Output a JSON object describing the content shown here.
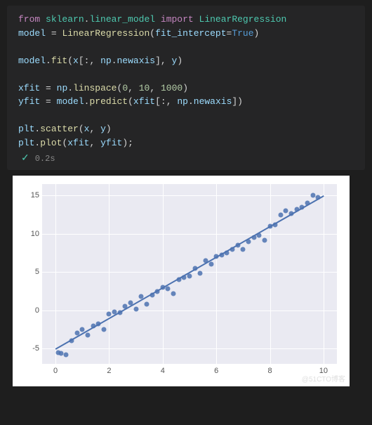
{
  "code": {
    "lines": [
      {
        "tokens": [
          [
            "kw",
            "from"
          ],
          [
            "",
            ""
          ],
          [
            "mod",
            "sklearn"
          ],
          [
            "punc",
            "."
          ],
          [
            "mod",
            "linear_model"
          ],
          [
            "",
            ""
          ],
          [
            "kw",
            "import"
          ],
          [
            "",
            ""
          ],
          [
            "mod",
            "LinearRegression"
          ]
        ]
      },
      {
        "tokens": [
          [
            "var",
            "model"
          ],
          [
            "",
            ""
          ],
          [
            "op",
            "="
          ],
          [
            "",
            ""
          ],
          [
            "fn",
            "LinearRegression"
          ],
          [
            "punc",
            "("
          ],
          [
            "param",
            "fit_intercept"
          ],
          [
            "op",
            "="
          ],
          [
            "bool",
            "True"
          ],
          [
            "punc",
            ")"
          ]
        ]
      },
      {
        "tokens": []
      },
      {
        "tokens": [
          [
            "var",
            "model"
          ],
          [
            "punc",
            "."
          ],
          [
            "fn",
            "fit"
          ],
          [
            "punc",
            "("
          ],
          [
            "var",
            "x"
          ],
          [
            "punc",
            "[:,"
          ],
          [
            "",
            ""
          ],
          [
            "var",
            "np"
          ],
          [
            "punc",
            "."
          ],
          [
            "var",
            "newaxis"
          ],
          [
            "punc",
            "],"
          ],
          [
            "",
            ""
          ],
          [
            "var",
            "y"
          ],
          [
            "punc",
            ")"
          ]
        ]
      },
      {
        "tokens": []
      },
      {
        "tokens": [
          [
            "var",
            "xfit"
          ],
          [
            "",
            ""
          ],
          [
            "op",
            "="
          ],
          [
            "",
            ""
          ],
          [
            "var",
            "np"
          ],
          [
            "punc",
            "."
          ],
          [
            "fn",
            "linspace"
          ],
          [
            "punc",
            "("
          ],
          [
            "num",
            "0"
          ],
          [
            "punc",
            ","
          ],
          [
            "",
            ""
          ],
          [
            "num",
            "10"
          ],
          [
            "punc",
            ","
          ],
          [
            "",
            ""
          ],
          [
            "num",
            "1000"
          ],
          [
            "punc",
            ")"
          ]
        ]
      },
      {
        "tokens": [
          [
            "var",
            "yfit"
          ],
          [
            "",
            ""
          ],
          [
            "op",
            "="
          ],
          [
            "",
            ""
          ],
          [
            "var",
            "model"
          ],
          [
            "punc",
            "."
          ],
          [
            "fn",
            "predict"
          ],
          [
            "punc",
            "("
          ],
          [
            "var",
            "xfit"
          ],
          [
            "punc",
            "[:,"
          ],
          [
            "",
            ""
          ],
          [
            "var",
            "np"
          ],
          [
            "punc",
            "."
          ],
          [
            "var",
            "newaxis"
          ],
          [
            "punc",
            "])"
          ]
        ]
      },
      {
        "tokens": []
      },
      {
        "tokens": [
          [
            "var",
            "plt"
          ],
          [
            "punc",
            "."
          ],
          [
            "fn",
            "scatter"
          ],
          [
            "punc",
            "("
          ],
          [
            "var",
            "x"
          ],
          [
            "punc",
            ","
          ],
          [
            "",
            ""
          ],
          [
            "var",
            "y"
          ],
          [
            "punc",
            ")"
          ]
        ]
      },
      {
        "tokens": [
          [
            "var",
            "plt"
          ],
          [
            "punc",
            "."
          ],
          [
            "fn",
            "plot"
          ],
          [
            "punc",
            "("
          ],
          [
            "var",
            "xfit"
          ],
          [
            "punc",
            ","
          ],
          [
            "",
            ""
          ],
          [
            "var",
            "yfit"
          ],
          [
            "punc",
            ");"
          ]
        ]
      }
    ]
  },
  "status": {
    "check": "✓",
    "time": "0.2s"
  },
  "chart_data": {
    "type": "scatter+line",
    "xlabel": "",
    "ylabel": "",
    "xlim": [
      -0.5,
      10.5
    ],
    "ylim": [
      -7,
      16.5
    ],
    "xticks": [
      0,
      2,
      4,
      6,
      8,
      10
    ],
    "yticks": [
      -5,
      0,
      5,
      10,
      15
    ],
    "scatter": {
      "x": [
        0.1,
        0.2,
        0.4,
        0.6,
        0.8,
        1.0,
        1.2,
        1.4,
        1.6,
        1.8,
        2.0,
        2.2,
        2.4,
        2.6,
        2.8,
        3.0,
        3.2,
        3.4,
        3.6,
        3.8,
        4.0,
        4.2,
        4.4,
        4.6,
        4.8,
        5.0,
        5.2,
        5.4,
        5.6,
        5.8,
        6.0,
        6.2,
        6.4,
        6.6,
        6.8,
        7.0,
        7.2,
        7.4,
        7.6,
        7.8,
        8.0,
        8.2,
        8.4,
        8.6,
        8.8,
        9.0,
        9.2,
        9.4,
        9.6,
        9.8
      ],
      "y": [
        -5.5,
        -5.6,
        -5.8,
        -4.0,
        -3.0,
        -2.5,
        -3.2,
        -2.0,
        -1.8,
        -2.5,
        -0.5,
        -0.2,
        -0.3,
        0.5,
        1.0,
        0.2,
        1.8,
        0.8,
        2.0,
        2.5,
        3.0,
        2.8,
        2.2,
        4.0,
        4.3,
        4.5,
        5.5,
        4.8,
        6.5,
        6.0,
        7.0,
        7.2,
        7.5,
        8.0,
        8.5,
        8.0,
        9.0,
        9.5,
        9.8,
        9.2,
        11.0,
        11.2,
        12.5,
        13.0,
        12.6,
        13.2,
        13.5,
        14.0,
        15.0,
        14.8
      ]
    },
    "line": {
      "slope": 2.0,
      "intercept": -5.0,
      "x_start": 0,
      "x_end": 10,
      "y_start": -5.0,
      "y_end": 15.0
    }
  },
  "watermark": "@51CTO博客"
}
